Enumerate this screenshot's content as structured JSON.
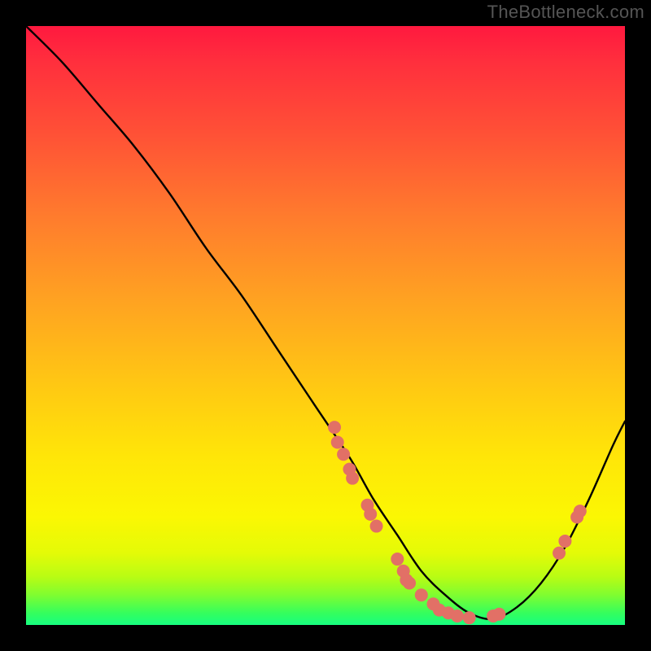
{
  "watermark": "TheBottleneck.com",
  "chart_data": {
    "type": "line",
    "title": "",
    "xlabel": "",
    "ylabel": "",
    "xlim": [
      0,
      100
    ],
    "ylim": [
      0,
      100
    ],
    "grid": false,
    "legend": false,
    "series": [
      {
        "name": "curve",
        "color": "#000000",
        "x": [
          0,
          6,
          12,
          18,
          24,
          30,
          36,
          42,
          48,
          54,
          58,
          62,
          66,
          70,
          74,
          78,
          82,
          86,
          90,
          94,
          98,
          100
        ],
        "y": [
          100,
          94,
          87,
          80,
          72,
          63,
          55,
          46,
          37,
          28,
          21,
          15,
          9,
          5,
          2,
          1,
          3,
          7,
          13,
          21,
          30,
          34
        ]
      }
    ],
    "markers": [
      {
        "x": 51.5,
        "y": 33.0
      },
      {
        "x": 52.0,
        "y": 30.5
      },
      {
        "x": 53.0,
        "y": 28.5
      },
      {
        "x": 54.0,
        "y": 26.0
      },
      {
        "x": 54.5,
        "y": 24.5
      },
      {
        "x": 57.0,
        "y": 20.0
      },
      {
        "x": 57.5,
        "y": 18.5
      },
      {
        "x": 58.5,
        "y": 16.5
      },
      {
        "x": 62.0,
        "y": 11.0
      },
      {
        "x": 63.0,
        "y": 9.0
      },
      {
        "x": 63.5,
        "y": 7.5
      },
      {
        "x": 64.0,
        "y": 7.0
      },
      {
        "x": 66.0,
        "y": 5.0
      },
      {
        "x": 68.0,
        "y": 3.5
      },
      {
        "x": 69.0,
        "y": 2.5
      },
      {
        "x": 70.5,
        "y": 2.0
      },
      {
        "x": 72.0,
        "y": 1.5
      },
      {
        "x": 74.0,
        "y": 1.2
      },
      {
        "x": 78.0,
        "y": 1.5
      },
      {
        "x": 79.0,
        "y": 1.8
      },
      {
        "x": 89.0,
        "y": 12.0
      },
      {
        "x": 90.0,
        "y": 14.0
      },
      {
        "x": 92.0,
        "y": 18.0
      },
      {
        "x": 92.5,
        "y": 19.0
      }
    ],
    "marker_style": {
      "color": "#e27066",
      "radius": 8
    },
    "background": {
      "type": "vertical-gradient",
      "stops": [
        {
          "pos": 0.0,
          "color": "#ff193f"
        },
        {
          "pos": 0.5,
          "color": "#ffc813"
        },
        {
          "pos": 0.82,
          "color": "#fbf703"
        },
        {
          "pos": 1.0,
          "color": "#17fe80"
        }
      ]
    }
  }
}
